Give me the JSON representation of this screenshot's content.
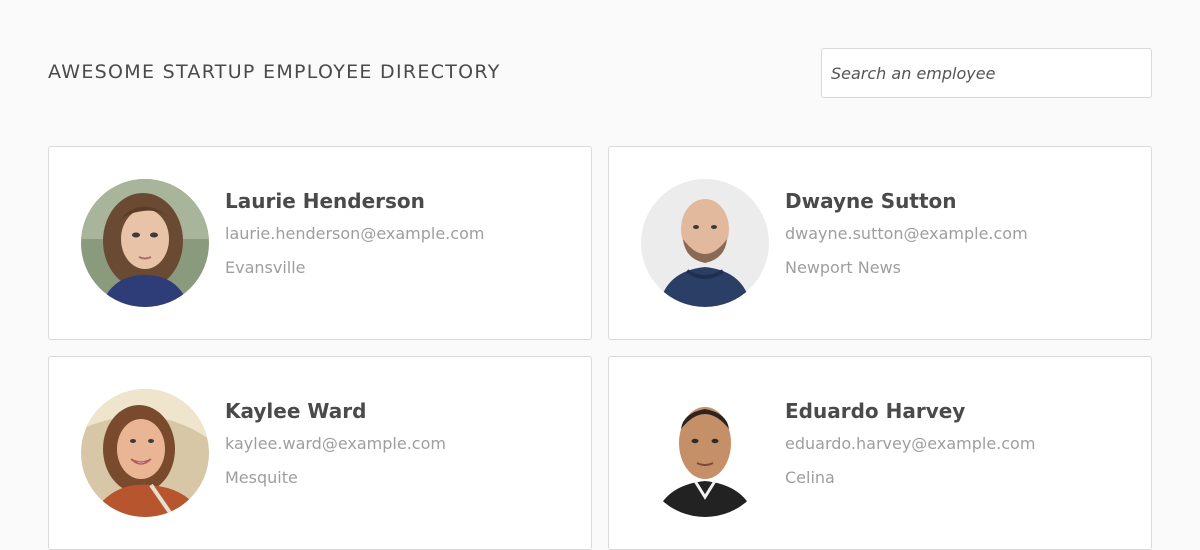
{
  "header": {
    "title": "AWESOME STARTUP EMPLOYEE DIRECTORY",
    "search_placeholder": "Search an employee"
  },
  "employees": [
    {
      "name": "Laurie Henderson",
      "email": "laurie.henderson@example.com",
      "city": "Evansville"
    },
    {
      "name": "Dwayne Sutton",
      "email": "dwayne.sutton@example.com",
      "city": "Newport News"
    },
    {
      "name": "Kaylee Ward",
      "email": "kaylee.ward@example.com",
      "city": "Mesquite"
    },
    {
      "name": "Eduardo Harvey",
      "email": "eduardo.harvey@example.com",
      "city": "Celina"
    }
  ],
  "colors": {
    "background": "#fafafa",
    "card": "#ffffff",
    "border": "#d9d9d9",
    "text": "#4a4a4a",
    "muted": "#9e9e9e"
  }
}
